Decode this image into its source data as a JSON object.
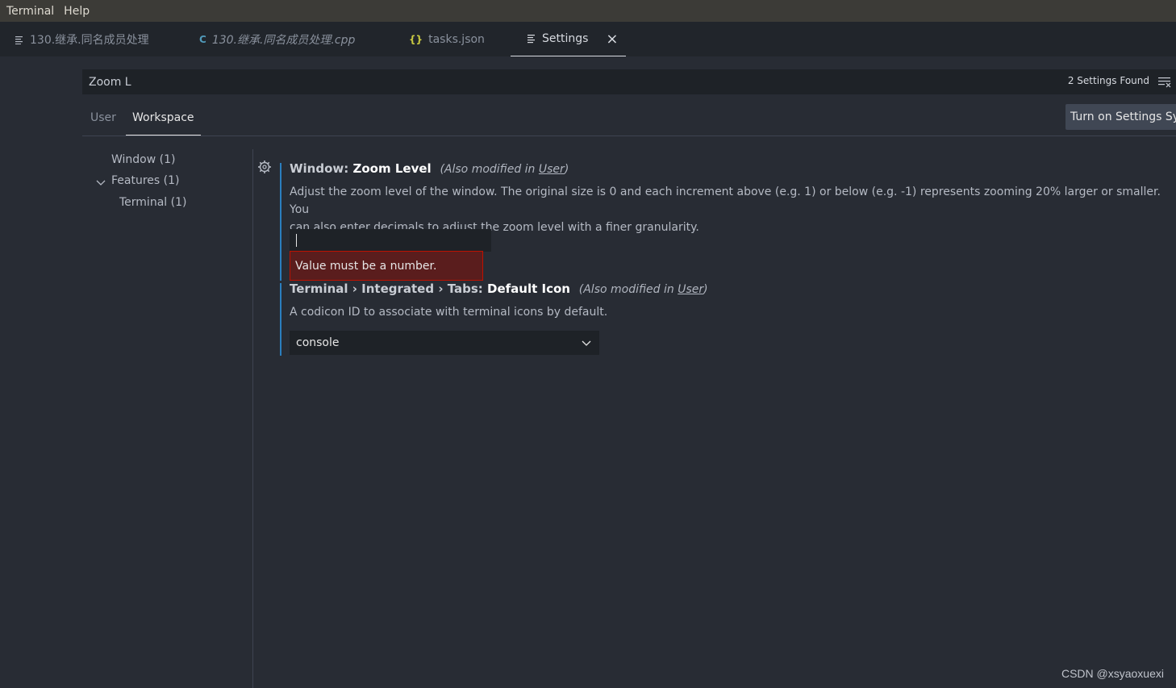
{
  "menubar": {
    "items": [
      "Terminal",
      "Help"
    ]
  },
  "tabs": [
    {
      "label": "130.继承.同名成员处理",
      "icon": "file-lines-icon",
      "italic": false
    },
    {
      "label": "130.继承.同名成员处理.cpp",
      "icon": "cpp-file-icon",
      "italic": true
    },
    {
      "label": "tasks.json",
      "icon": "json-braces-icon",
      "italic": false
    },
    {
      "label": "Settings",
      "icon": "settings-lines-icon",
      "active": true
    }
  ],
  "search": {
    "value": "Zoom L",
    "found_count": "2 Settings Found"
  },
  "scope_tabs": {
    "user": "User",
    "workspace": "Workspace",
    "active": "Workspace"
  },
  "sync_button": "Turn on Settings Sync",
  "toc": {
    "window": "Window (1)",
    "features": "Features (1)",
    "terminal": "Terminal (1)"
  },
  "settings": [
    {
      "category": "Window: ",
      "key": "Zoom Level",
      "modified_prefix": "(Also modified in ",
      "modified_link": "User",
      "modified_suffix": ")",
      "description_line1": "Adjust the zoom level of the window. The original size is 0 and each increment above (e.g. 1) or below (e.g. -1) represents zooming 20% larger or smaller. You",
      "description_line2": "can also enter decimals to adjust the zoom level with a finer granularity.",
      "value": "",
      "error": "Value must be a number."
    },
    {
      "category": "Terminal › Integrated › Tabs: ",
      "key": "Default Icon",
      "modified_prefix": "(Also modified in ",
      "modified_link": "User",
      "modified_suffix": ")",
      "description": "A codicon ID to associate with terminal icons by default.",
      "value": "console"
    }
  ],
  "watermark": "CSDN @xsyaoxuexi",
  "colors": {
    "accent_bar": "#2b7fbf",
    "error_bg": "#5a1d1d",
    "error_border": "#be1100"
  }
}
